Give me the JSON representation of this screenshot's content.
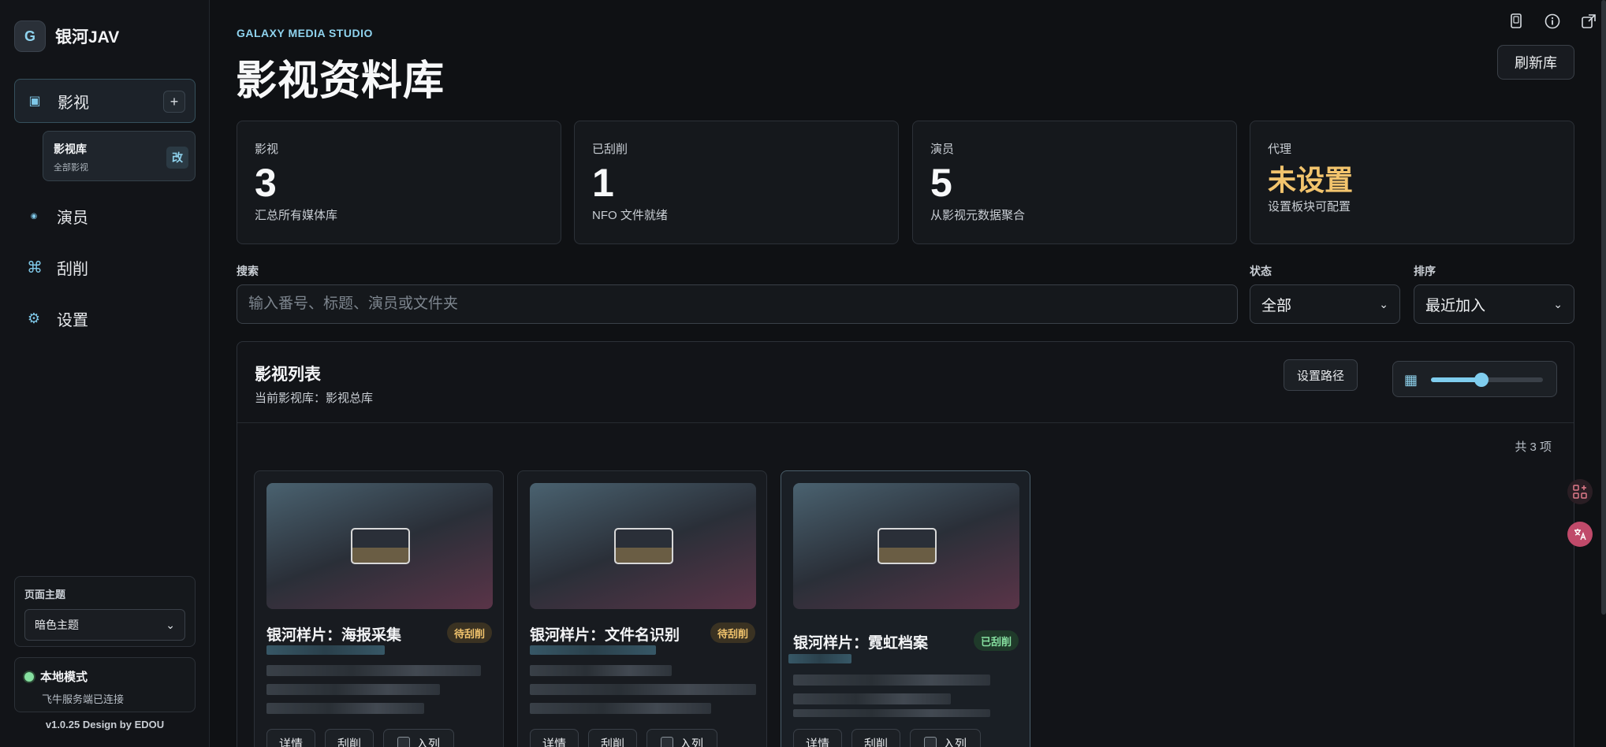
{
  "brand": {
    "logo": "G",
    "name": "银河JAV"
  },
  "nav": {
    "film": {
      "label": "影视",
      "icon": "▣",
      "add": "+"
    },
    "sub": {
      "title": "影视库",
      "subtitle": "全部影视",
      "edit": "改"
    },
    "actor": {
      "label": "演员",
      "icon": "◉"
    },
    "scrape": {
      "label": "刮削",
      "icon": "⌘"
    },
    "settings": {
      "label": "设置",
      "icon": "⚙"
    }
  },
  "theme": {
    "label": "页面主题",
    "value": "暗色主题"
  },
  "mode": {
    "title": "本地模式",
    "subtitle": "飞牛服务端已连接"
  },
  "version": "v1.0.25 Design by EDOU",
  "header": {
    "kicker": "GALAXY MEDIA STUDIO",
    "title": "影视资料库",
    "refresh": "刷新库"
  },
  "stats": [
    {
      "label": "影视",
      "value": "3",
      "desc": "汇总所有媒体库"
    },
    {
      "label": "已刮削",
      "value": "1",
      "desc": "NFO 文件就绪"
    },
    {
      "label": "演员",
      "value": "5",
      "desc": "从影视元数据聚合"
    },
    {
      "label": "代理",
      "value": "未设置",
      "desc": "设置板块可配置"
    }
  ],
  "filters": {
    "search_label": "搜索",
    "search_placeholder": "输入番号、标题、演员或文件夹",
    "status_label": "状态",
    "status_value": "全部",
    "sort_label": "排序",
    "sort_value": "最近加入"
  },
  "list": {
    "title": "影视列表",
    "subtitle": "当前影视库：影视总库",
    "path_button": "设置路径",
    "zoom_level": 0.45,
    "count": "共 3 项"
  },
  "cards": [
    {
      "title": "银河样片：海报采集",
      "badge": "待刮削",
      "status": "pending",
      "buttons": [
        "详情",
        "刮削",
        "入列"
      ]
    },
    {
      "title": "银河样片：文件名识别",
      "badge": "待刮削",
      "status": "pending",
      "buttons": [
        "详情",
        "刮削",
        "入列"
      ]
    },
    {
      "title": "银河样片：霓虹档案",
      "badge": "已刮削",
      "status": "done",
      "buttons": [
        "详情",
        "刮削",
        "入列"
      ]
    }
  ],
  "colors": {
    "accent": "#7fcdee",
    "warn": "#f2c46d",
    "success": "#86e0a0",
    "background": "#0f1114"
  }
}
